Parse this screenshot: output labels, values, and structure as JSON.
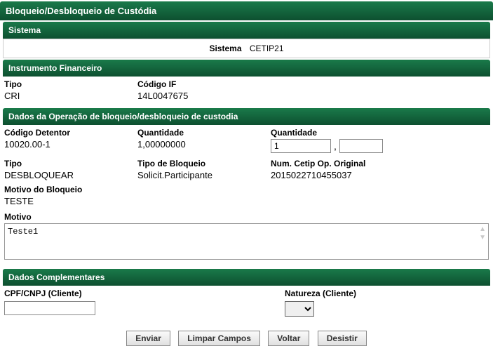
{
  "page": {
    "title": "Bloqueio/Desbloqueio de Custódia"
  },
  "sections": {
    "sistema": {
      "title": "Sistema",
      "field_label": "Sistema",
      "field_value": "CETIP21"
    },
    "instrumento": {
      "title": "Instrumento Financeiro",
      "tipo_label": "Tipo",
      "tipo_value": "CRI",
      "codigoif_label": "Código IF",
      "codigoif_value": "14L0047675"
    },
    "operacao": {
      "title": "Dados da Operação de bloqueio/desbloqueio de custodia",
      "codigo_detentor_label": "Código Detentor",
      "codigo_detentor_value": "10020.00-1",
      "quantidade_label": "Quantidade",
      "quantidade_value": "1,00000000",
      "quantidade_input_label": "Quantidade",
      "quantidade_int_value": "1",
      "quantidade_dec_value": "",
      "tipo_label": "Tipo",
      "tipo_value": "DESBLOQUEAR",
      "tipo_bloqueio_label": "Tipo de Bloqueio",
      "tipo_bloqueio_value": "Solicit.Participante",
      "num_cetip_label": "Num. Cetip Op. Original",
      "num_cetip_value": "2015022710455037",
      "motivo_bloqueio_label": "Motivo do Bloqueio",
      "motivo_bloqueio_value": "TESTE",
      "motivo_label": "Motivo",
      "motivo_text": "Teste1"
    },
    "complementares": {
      "title": "Dados Complementares",
      "cpf_label": "CPF/CNPJ (Cliente)",
      "cpf_value": "",
      "natureza_label": "Natureza (Cliente)",
      "natureza_value": ""
    }
  },
  "buttons": {
    "enviar": "Enviar",
    "limpar": "Limpar Campos",
    "voltar": "Voltar",
    "desistir": "Desistir"
  }
}
